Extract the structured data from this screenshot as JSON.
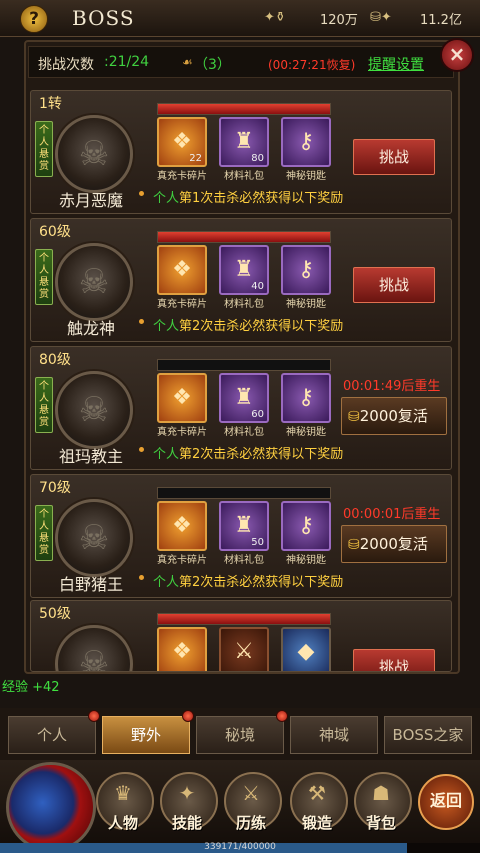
{
  "header": {
    "title": "BOSS",
    "help_label": "?",
    "resources": [
      {
        "icon": "winged-gold-icon",
        "value": "120万"
      },
      {
        "icon": "gold-ingot-icon",
        "value": "11.2亿"
      }
    ]
  },
  "info_bar": {
    "attempts_label": "挑战次数",
    "attempts_value": ":21/24",
    "tickets_value": "（3）",
    "recover_timer": "(00:27:21恢复)",
    "reminder_link": "提醒设置",
    "close_label": "×"
  },
  "bosses": [
    {
      "level": "1转",
      "name": "赤月恶魔",
      "hp": 1.0,
      "bounty": "个人悬赏",
      "items": [
        {
          "label": "真充卡碎片",
          "count": "22",
          "icon": "card-shard-icon",
          "glyph": "❖"
        },
        {
          "label": "材料礼包",
          "count": "80",
          "icon": "material-bag-icon",
          "glyph": "♜"
        },
        {
          "label": "神秘钥匙",
          "count": "",
          "icon": "mystic-key-icon",
          "glyph": "⚷"
        }
      ],
      "reward_prefix": "个人",
      "reward_text": "第1次击杀必然获得以下奖励",
      "action": {
        "type": "challenge",
        "label": "挑战"
      }
    },
    {
      "level": "60级",
      "name": "触龙神",
      "hp": 1.0,
      "bounty": "个人悬赏",
      "items": [
        {
          "label": "真充卡碎片",
          "count": "",
          "icon": "card-shard-icon",
          "glyph": "❖"
        },
        {
          "label": "材料礼包",
          "count": "40",
          "icon": "material-bag-icon",
          "glyph": "♜"
        },
        {
          "label": "神秘钥匙",
          "count": "",
          "icon": "mystic-key-icon",
          "glyph": "⚷"
        }
      ],
      "reward_prefix": "个人",
      "reward_text": "第2次击杀必然获得以下奖励",
      "action": {
        "type": "challenge",
        "label": "挑战"
      }
    },
    {
      "level": "80级",
      "name": "祖玛教主",
      "hp": 0.0,
      "bounty": "个人悬赏",
      "items": [
        {
          "label": "真充卡碎片",
          "count": "",
          "icon": "card-shard-icon",
          "glyph": "❖"
        },
        {
          "label": "材料礼包",
          "count": "60",
          "icon": "material-bag-icon",
          "glyph": "♜"
        },
        {
          "label": "神秘钥匙",
          "count": "",
          "icon": "mystic-key-icon",
          "glyph": "⚷"
        }
      ],
      "reward_prefix": "个人",
      "reward_text": "第2次击杀必然获得以下奖励",
      "action": {
        "type": "revive",
        "timer": "00:01:49后重生",
        "label": "2000复活"
      }
    },
    {
      "level": "70级",
      "name": "白野猪王",
      "hp": 0.0,
      "bounty": "个人悬赏",
      "items": [
        {
          "label": "真充卡碎片",
          "count": "",
          "icon": "card-shard-icon",
          "glyph": "❖"
        },
        {
          "label": "材料礼包",
          "count": "50",
          "icon": "material-bag-icon",
          "glyph": "♜"
        },
        {
          "label": "神秘钥匙",
          "count": "",
          "icon": "mystic-key-icon",
          "glyph": "⚷"
        }
      ],
      "reward_prefix": "个人",
      "reward_text": "第2次击杀必然获得以下奖励",
      "action": {
        "type": "revive",
        "timer": "00:00:01后重生",
        "label": "2000复活"
      }
    },
    {
      "level": "50级",
      "name": "",
      "hp": 1.0,
      "bounty": "",
      "items": [
        {
          "label": "",
          "count": "",
          "icon": "card-shard-icon",
          "glyph": "❖"
        },
        {
          "label": "",
          "count": "",
          "icon": "sword-icon",
          "glyph": "⚔"
        },
        {
          "label": "",
          "count": "",
          "icon": "crystal-icon",
          "glyph": "◆"
        }
      ],
      "reward_prefix": "",
      "reward_text": "",
      "action": {
        "type": "challenge",
        "label": "挑战"
      }
    }
  ],
  "exp_log": "经验 +42",
  "tabs": [
    {
      "label": "个人",
      "active": false,
      "dot": true
    },
    {
      "label": "野外",
      "active": true,
      "dot": true
    },
    {
      "label": "秘境",
      "active": false,
      "dot": true
    },
    {
      "label": "神域",
      "active": false,
      "dot": false
    },
    {
      "label": "BOSS之家",
      "active": false,
      "dot": false
    }
  ],
  "nav": [
    {
      "label": "人物",
      "icon": "helmet-icon",
      "glyph": "♛"
    },
    {
      "label": "技能",
      "icon": "skill-book-icon",
      "glyph": "✦"
    },
    {
      "label": "历练",
      "icon": "trial-icon",
      "glyph": "⚔"
    },
    {
      "label": "锻造",
      "icon": "anvil-icon",
      "glyph": "⚒"
    },
    {
      "label": "背包",
      "icon": "bag-icon",
      "glyph": "☗"
    }
  ],
  "back_label": "返回",
  "xp": {
    "text": "339171/400000",
    "fraction": 0.848
  },
  "colors": {
    "accent_green": "#40d040",
    "timer_red": "#ff3a2a",
    "gold": "#ffd040"
  }
}
